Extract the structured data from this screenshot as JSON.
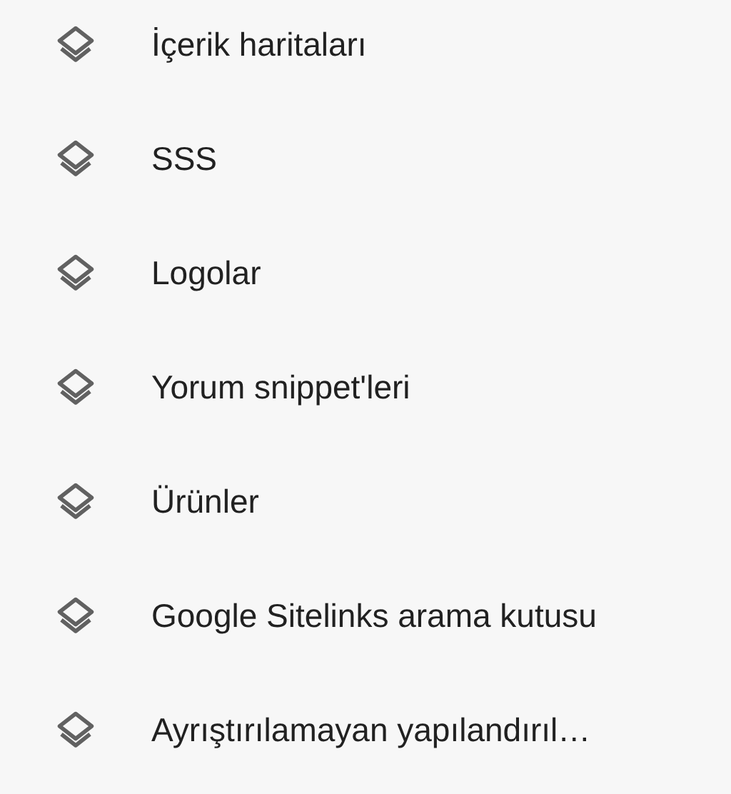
{
  "items": [
    {
      "label": "İçerik haritaları"
    },
    {
      "label": "SSS"
    },
    {
      "label": "Logolar"
    },
    {
      "label": "Yorum snippet'leri"
    },
    {
      "label": "Ürünler"
    },
    {
      "label": "Google Sitelinks arama kutusu"
    },
    {
      "label": "Ayrıştırılamayan yapılandırıl…"
    }
  ]
}
